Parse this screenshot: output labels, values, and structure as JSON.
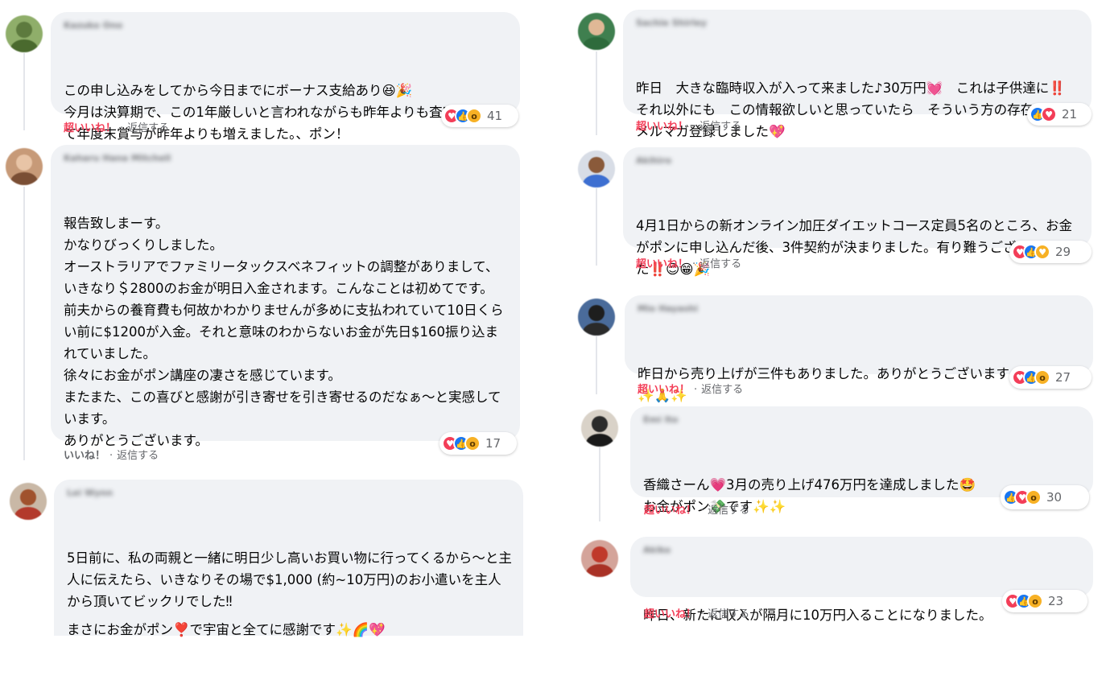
{
  "labels": {
    "super_like": "超いいね！",
    "like": "いいね！",
    "reply": "返信する",
    "separator": "·"
  },
  "colors": {
    "bubble": "#f0f2f5",
    "super_like": "#f33e58",
    "meta_text": "#65676b",
    "reaction_like": "#1877f2",
    "reaction_love": "#f33e58",
    "reaction_wow": "#f7b125"
  },
  "comments": [
    {
      "author": "Kazuko Ono",
      "lines": [
        "この申し込みをしてから今日までにボーナス支給あり😆🎉",
        "今月は決算期で、この1年厳しいと言われながらも昨年よりも査定が伸びて年度末賞与が昨年よりも増えました。、ポン！"
      ],
      "action": "超いいね！",
      "reactions": [
        "love-icon",
        "like-icon",
        "wow-icon"
      ],
      "count": "41"
    },
    {
      "author": "Kaharu Hana Mitchell",
      "lines": [
        "報告致しまーす。",
        "かなりびっくりしました。",
        "オーストラリアでファミリータックスベネフィットの調整がありまして、いきなり＄2800のお金が明日入金されます。こんなことは初めてです。",
        "前夫からの養育費も何故かわかりませんが多めに支払われていて10日くらい前に$1200が入金。それと意味のわからないお金が先日$160振り込まれていました。",
        "徐々にお金がポン講座の凄さを感じています。",
        "またまた、この喜びと感謝が引き寄せを引き寄せるのだなぁ〜と実感しています。",
        "ありがとうございます。"
      ],
      "action": "いいね！",
      "reactions": [
        "love-icon",
        "like-icon",
        "wow-icon"
      ],
      "count": "17"
    },
    {
      "author": "Lei Wynn",
      "lines": [
        "5日前に、私の両親と一緒に明日少し高いお買い物に行ってくるから〜と主人に伝えたら、いきなりその場で$1,000 (約~10万円)のお小遣いを主人から頂いてビックリでした‼",
        "まさにお金がポン❣️で宇宙と全てに感謝です✨🌈💖"
      ],
      "action": "",
      "reactions": [],
      "count": ""
    },
    {
      "author": "Sachie Shirley",
      "lines": [
        "昨日　大きな臨時収入が入って来ました♪30万円💓　これは子供達に‼️　それ以外にも　この情報欲しいと思っていたら　そういう方の存在を知りメルマガ登録しました💖"
      ],
      "action": "超いいね！",
      "reactions": [
        "like-icon",
        "love-icon"
      ],
      "count": "21"
    },
    {
      "author": "Akihiro",
      "lines": [
        "4月1日からの新オンライン加圧ダイエットコース定員5名のところ、お金がポンに申し込んだ後、3件契約が決まりました。有り難うございました‼️😊😁🎉"
      ],
      "action": "超いいね！",
      "reactions": [
        "love-icon",
        "like-icon",
        "care-icon"
      ],
      "count": "29"
    },
    {
      "author": "Mio Hayashi",
      "lines": [
        "昨日から売り上げが三件もありました。ありがとうございます",
        "✨🙏✨"
      ],
      "action": "超いいね！",
      "reactions": [
        "love-icon",
        "like-icon",
        "wow-icon"
      ],
      "count": "27"
    },
    {
      "author": "Emi Ito",
      "lines": [
        "香織さーん💗3月の売り上げ476万円を達成しました🤩",
        "お金がポン💸です✨✨"
      ],
      "action": "超いいね！",
      "reactions": [
        "like-icon",
        "love-icon",
        "wow-icon"
      ],
      "count": "30"
    },
    {
      "author": "Akiko",
      "lines": [
        "昨日、新たに収入が隔月に10万円入ることになりました。"
      ],
      "action": "超いいね！",
      "reactions": [
        "love-icon",
        "like-icon",
        "wow-icon"
      ],
      "count": "23"
    }
  ]
}
